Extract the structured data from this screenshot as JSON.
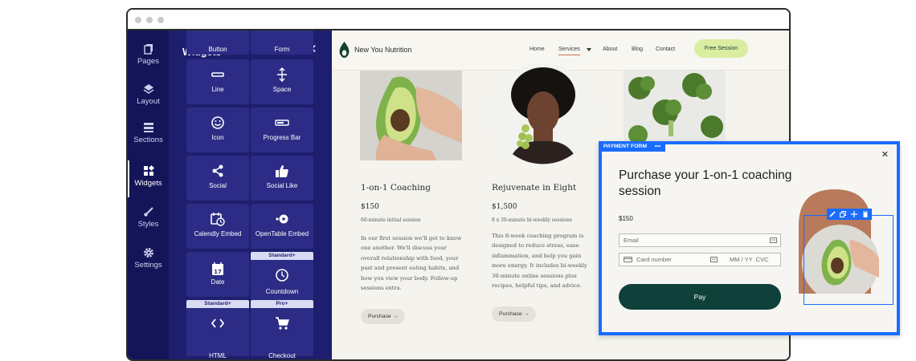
{
  "sidebar": {
    "items": [
      {
        "label": "Pages",
        "icon": "pages-icon"
      },
      {
        "label": "Layout",
        "icon": "layers-icon"
      },
      {
        "label": "Sections",
        "icon": "sections-icon"
      },
      {
        "label": "Widgets",
        "icon": "widgets-icon"
      },
      {
        "label": "Styles",
        "icon": "brush-icon"
      },
      {
        "label": "Settings",
        "icon": "gear-icon"
      }
    ],
    "active": "Widgets"
  },
  "widgets_panel": {
    "title": "Widgets",
    "close": "✕",
    "widgets": [
      {
        "label": "Button",
        "icon": "button-icon"
      },
      {
        "label": "Form",
        "icon": "form-icon"
      },
      {
        "label": "Line",
        "icon": "line-icon"
      },
      {
        "label": "Space",
        "icon": "space-icon"
      },
      {
        "label": "Icon",
        "icon": "smiley-icon"
      },
      {
        "label": "Progress Bar",
        "icon": "progress-bar-icon"
      },
      {
        "label": "Social",
        "icon": "share-icon"
      },
      {
        "label": "Social Like",
        "icon": "thumbs-up-icon"
      },
      {
        "label": "Calendly Embed",
        "icon": "calendar-clock-icon"
      },
      {
        "label": "OpenTable Embed",
        "icon": "opentable-icon"
      },
      {
        "label": "Date",
        "icon": "calendar-icon"
      },
      {
        "label": "Countdown",
        "icon": "clock-icon"
      },
      {
        "label": "HTML",
        "icon": "code-icon"
      },
      {
        "label": "Checkout",
        "icon": "cart-icon"
      }
    ],
    "tags": {
      "countdown": "Standard+",
      "html": "Standard+",
      "checkout": "Pro+"
    }
  },
  "site": {
    "brand": "New You Nutrition",
    "nav": [
      "Home",
      "Services",
      "About",
      "Blog",
      "Contact"
    ],
    "cta": "Free Session",
    "products": [
      {
        "title": "1-on-1 Coaching",
        "price": "$150",
        "sub": "60-minute initial session",
        "desc": [
          "In our first session we'll get to know",
          "one another. We'll discuss your",
          "overall relationship with food, your",
          "past and present eating habits, and",
          "how you view your body. Follow-up",
          "sessions extra."
        ],
        "button": "Purchase →"
      },
      {
        "title": "Rejuvenate in Eight",
        "price": "$1,500",
        "sub": "8 x 30-minute bi-weekly sessions",
        "desc": [
          "This 8-week coaching program is",
          "designed to reduce stress, ease",
          "inflammation, and help you gain",
          "more energy. It includes bi-weekly",
          "30-minute online sessions plus",
          "recipes, helpful tips, and advice."
        ],
        "button": "Purchase →"
      }
    ]
  },
  "payment_form": {
    "label": "PAYMENT FORM",
    "menu": "•••",
    "close": "✕",
    "title": "Purchase your 1-on-1 coaching session",
    "price": "$150",
    "email_placeholder": "Email",
    "card_placeholder": "Card number",
    "expiry_cvc": "MM / YY  CVC",
    "pay": "Pay"
  },
  "colors": {
    "nav_bg": "#141459",
    "panel_bg": "#1e1e6e",
    "card_bg": "#2c2c86",
    "accent_blue": "#1a6cff",
    "cta_green": "#d9eea1",
    "pay_green": "#10403a"
  }
}
